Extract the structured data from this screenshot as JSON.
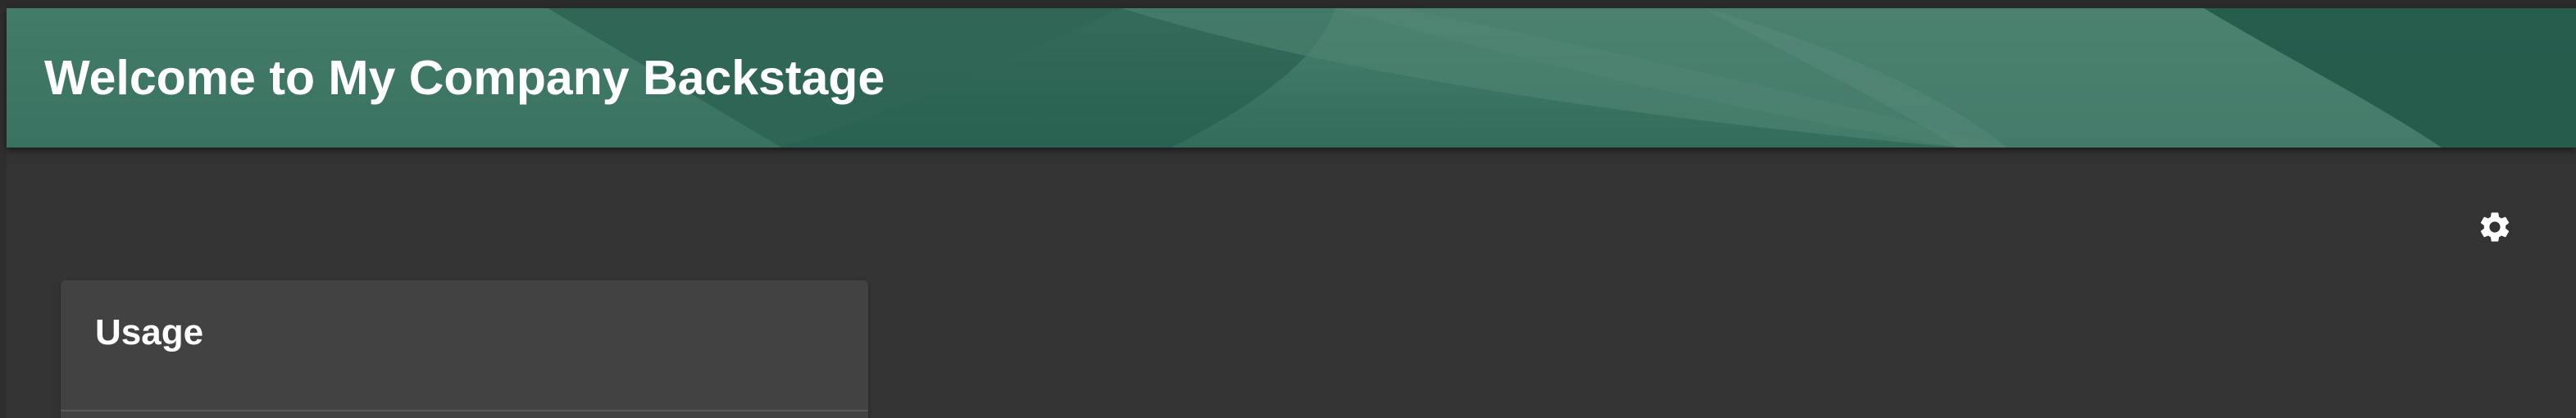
{
  "header": {
    "title": "Welcome to My Company Backstage"
  },
  "toolbar": {
    "settings_icon": "gear-icon"
  },
  "card": {
    "title": "Usage"
  },
  "colors": {
    "page_background": "#333333",
    "header_background": "#3c7664",
    "header_accent_dark": "#23594a",
    "card_background": "#424242",
    "text": "#ffffff"
  }
}
